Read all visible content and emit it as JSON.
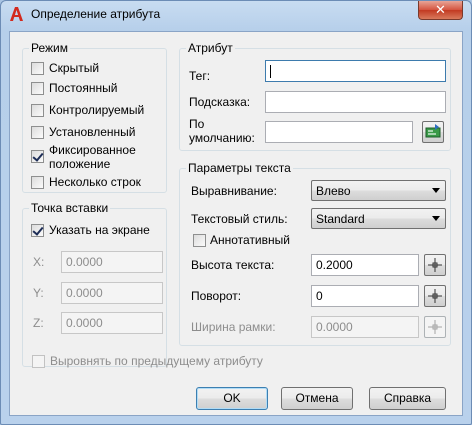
{
  "window": {
    "title": "Определение атрибута",
    "close_label": "✕"
  },
  "mode": {
    "title": "Режим",
    "items": [
      {
        "label": "Скрытый",
        "checked": false
      },
      {
        "label": "Постоянный",
        "checked": false
      },
      {
        "label": "Контролируемый",
        "checked": false
      },
      {
        "label": "Установленный",
        "checked": false
      },
      {
        "label_line1": "Фиксированное",
        "label_line2": "положение",
        "checked": true
      },
      {
        "label": "Несколько строк",
        "checked": false
      }
    ]
  },
  "insertion": {
    "title": "Точка вставки",
    "specify_on_screen": {
      "label": "Указать на экране",
      "checked": true
    },
    "x": {
      "label": "X:",
      "value": "0.0000"
    },
    "y": {
      "label": "Y:",
      "value": "0.0000"
    },
    "z": {
      "label": "Z:",
      "value": "0.0000"
    }
  },
  "attribute": {
    "title": "Атрибут",
    "tag_label": "Тег:",
    "tag_value": "",
    "prompt_label": "Подсказка:",
    "prompt_value": "",
    "default_label_line1": "По",
    "default_label_line2": "умолчанию:",
    "default_value": ""
  },
  "text_settings": {
    "title": "Параметры текста",
    "justification_label": "Выравнивание:",
    "justification_value": "Влево",
    "style_label": "Текстовый стиль:",
    "style_value": "Standard",
    "annotative_label": "Аннотативный",
    "annotative_checked": false,
    "height_label": "Высота текста:",
    "height_value": "0.2000",
    "rotation_label": "Поворот:",
    "rotation_value": "0",
    "width_label": "Ширина рамки:",
    "width_value": "0.0000"
  },
  "align_previous": {
    "label": "Выровнять по предыдущему атрибуту",
    "checked": false
  },
  "buttons": {
    "ok": "OK",
    "cancel": "Отмена",
    "help": "Справка"
  }
}
